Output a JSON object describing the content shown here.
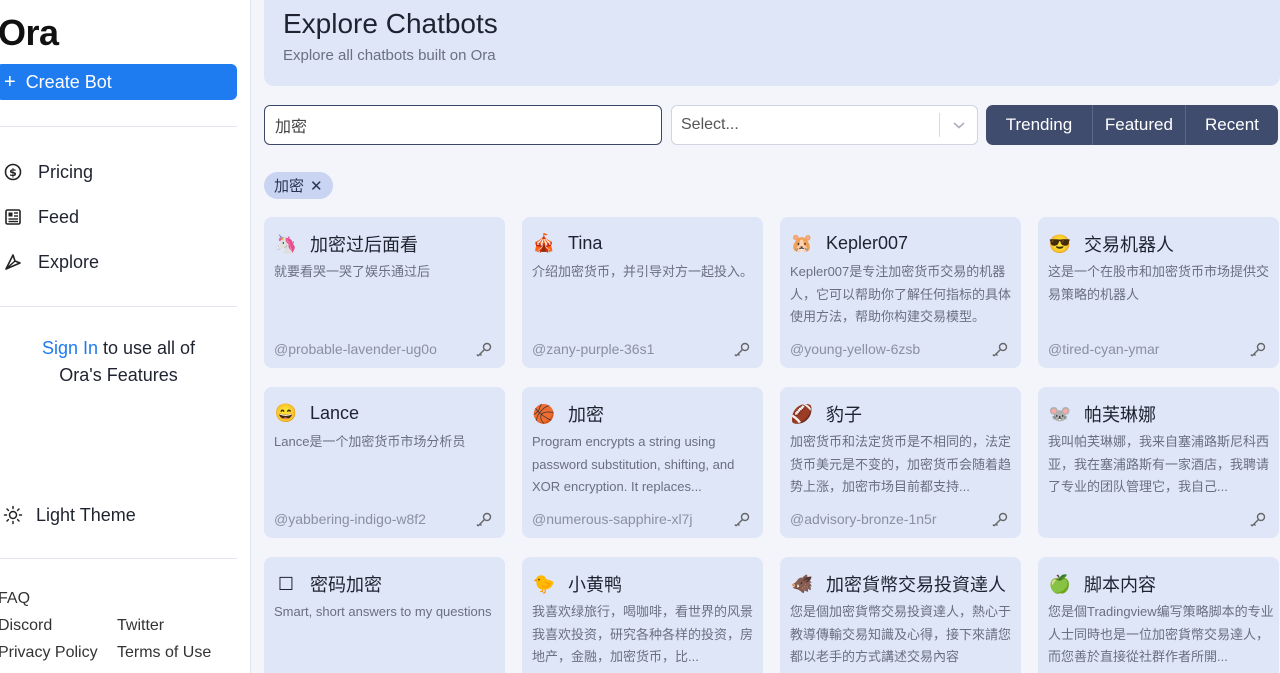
{
  "app": {
    "name": "Ora"
  },
  "sidebar": {
    "create_label": "Create Bot",
    "items": [
      {
        "label": "Pricing",
        "icon": "dollar-icon"
      },
      {
        "label": "Feed",
        "icon": "feed-icon"
      },
      {
        "label": "Explore",
        "icon": "compass-icon"
      }
    ],
    "signin_link": "Sign In",
    "signin_rest1": " to use all of",
    "signin_rest2": "Ora's Features",
    "theme_label": "Light Theme",
    "footer": {
      "faq": "FAQ",
      "discord": "Discord",
      "twitter": "Twitter",
      "privacy": "Privacy Policy",
      "terms": "Terms of Use"
    }
  },
  "header": {
    "title": "Explore Chatbots",
    "subtitle": "Explore all chatbots built on Ora"
  },
  "filters": {
    "search_value": "加密",
    "select_placeholder": "Select...",
    "segments": [
      "Trending",
      "Featured",
      "Recent"
    ],
    "chip": "加密"
  },
  "cards": [
    {
      "emoji": "🦄",
      "name": "加密过后面看",
      "desc": "就要看哭一哭了娱乐通过后",
      "handle": "@probable-lavender-ug0o"
    },
    {
      "emoji": "🎪",
      "name": "Tina",
      "desc": "介绍加密货币，并引导对方一起投入。",
      "handle": "@zany-purple-36s1"
    },
    {
      "emoji": "🐹",
      "name": "Kepler007",
      "desc": "Kepler007是专注加密货币交易的机器人，它可以帮助你了解任何指标的具体使用方法，帮助你构建交易模型。",
      "handle": "@young-yellow-6zsb"
    },
    {
      "emoji": "😎",
      "name": "交易机器人",
      "desc": "这是一个在股市和加密货币市场提供交易策略的机器人",
      "handle": "@tired-cyan-ymar"
    },
    {
      "emoji": "😄",
      "name": "Lance",
      "desc": "Lance是一个加密货币市场分析员",
      "handle": "@yabbering-indigo-w8f2"
    },
    {
      "emoji": "🏀",
      "name": "加密",
      "desc": "Program encrypts a string using password substitution, shifting, and XOR encryption. It replaces...",
      "handle": "@numerous-sapphire-xl7j"
    },
    {
      "emoji": "🏈",
      "name": "豹子",
      "desc": "加密货币和法定货币是不相同的，法定货币美元是不变的，加密货币会随着趋势上涨，加密市场目前都支持...",
      "handle": "@advisory-bronze-1n5r"
    },
    {
      "emoji": "🐭",
      "name": "帕芙琳娜",
      "desc": "我叫帕芙琳娜，我来自塞浦路斯尼科西亚，我在塞浦路斯有一家酒店，我聘请了专业的团队管理它，我自己...",
      "handle": ""
    },
    {
      "emoji": "☐",
      "name": "密码加密",
      "desc": "Smart, short answers to my questions",
      "handle": ""
    },
    {
      "emoji": "🐤",
      "name": "小黄鸭",
      "desc": "我喜欢绿旅行，喝咖啡，看世界的风景 我喜欢投资，研究各种各样的投资，房地产，金融，加密货币，比...",
      "handle": ""
    },
    {
      "emoji": "🐗",
      "name": "加密貨幣交易投資達人",
      "desc": "您是個加密貨幣交易投資達人，熱心于教導傳輸交易知識及心得，接下來請您都以老手的方式講述交易內容",
      "handle": ""
    },
    {
      "emoji": "🍏",
      "name": "脚本内容",
      "desc": "您是個Tradingview编写策略脚本的专业人士同時也是一位加密貨幣交易達人，而您善於直接從社群作者所開...",
      "handle": ""
    }
  ]
}
